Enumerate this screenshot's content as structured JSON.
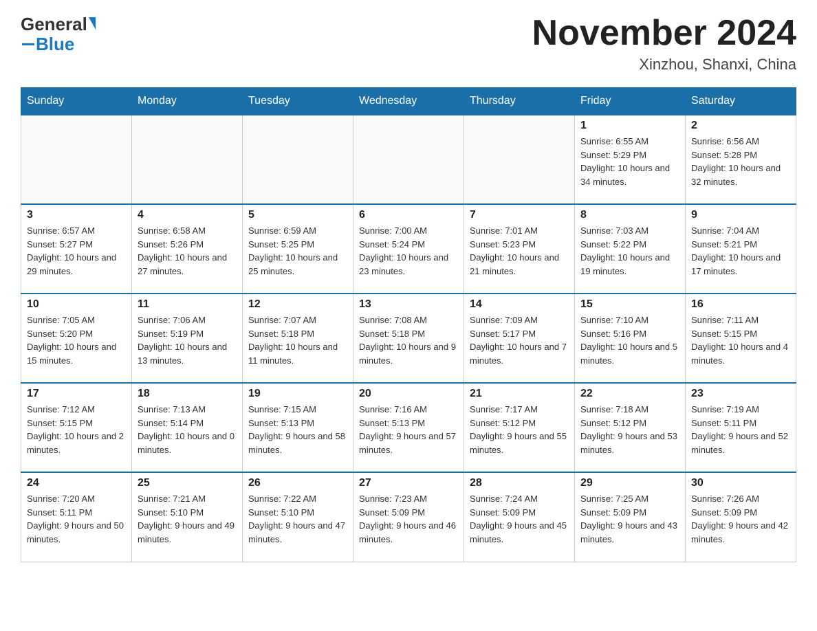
{
  "header": {
    "logo_general": "General",
    "logo_blue": "Blue",
    "month_title": "November 2024",
    "location": "Xinzhou, Shanxi, China"
  },
  "weekdays": [
    "Sunday",
    "Monday",
    "Tuesday",
    "Wednesday",
    "Thursday",
    "Friday",
    "Saturday"
  ],
  "weeks": [
    [
      {
        "day": "",
        "info": ""
      },
      {
        "day": "",
        "info": ""
      },
      {
        "day": "",
        "info": ""
      },
      {
        "day": "",
        "info": ""
      },
      {
        "day": "",
        "info": ""
      },
      {
        "day": "1",
        "info": "Sunrise: 6:55 AM\nSunset: 5:29 PM\nDaylight: 10 hours and 34 minutes."
      },
      {
        "day": "2",
        "info": "Sunrise: 6:56 AM\nSunset: 5:28 PM\nDaylight: 10 hours and 32 minutes."
      }
    ],
    [
      {
        "day": "3",
        "info": "Sunrise: 6:57 AM\nSunset: 5:27 PM\nDaylight: 10 hours and 29 minutes."
      },
      {
        "day": "4",
        "info": "Sunrise: 6:58 AM\nSunset: 5:26 PM\nDaylight: 10 hours and 27 minutes."
      },
      {
        "day": "5",
        "info": "Sunrise: 6:59 AM\nSunset: 5:25 PM\nDaylight: 10 hours and 25 minutes."
      },
      {
        "day": "6",
        "info": "Sunrise: 7:00 AM\nSunset: 5:24 PM\nDaylight: 10 hours and 23 minutes."
      },
      {
        "day": "7",
        "info": "Sunrise: 7:01 AM\nSunset: 5:23 PM\nDaylight: 10 hours and 21 minutes."
      },
      {
        "day": "8",
        "info": "Sunrise: 7:03 AM\nSunset: 5:22 PM\nDaylight: 10 hours and 19 minutes."
      },
      {
        "day": "9",
        "info": "Sunrise: 7:04 AM\nSunset: 5:21 PM\nDaylight: 10 hours and 17 minutes."
      }
    ],
    [
      {
        "day": "10",
        "info": "Sunrise: 7:05 AM\nSunset: 5:20 PM\nDaylight: 10 hours and 15 minutes."
      },
      {
        "day": "11",
        "info": "Sunrise: 7:06 AM\nSunset: 5:19 PM\nDaylight: 10 hours and 13 minutes."
      },
      {
        "day": "12",
        "info": "Sunrise: 7:07 AM\nSunset: 5:18 PM\nDaylight: 10 hours and 11 minutes."
      },
      {
        "day": "13",
        "info": "Sunrise: 7:08 AM\nSunset: 5:18 PM\nDaylight: 10 hours and 9 minutes."
      },
      {
        "day": "14",
        "info": "Sunrise: 7:09 AM\nSunset: 5:17 PM\nDaylight: 10 hours and 7 minutes."
      },
      {
        "day": "15",
        "info": "Sunrise: 7:10 AM\nSunset: 5:16 PM\nDaylight: 10 hours and 5 minutes."
      },
      {
        "day": "16",
        "info": "Sunrise: 7:11 AM\nSunset: 5:15 PM\nDaylight: 10 hours and 4 minutes."
      }
    ],
    [
      {
        "day": "17",
        "info": "Sunrise: 7:12 AM\nSunset: 5:15 PM\nDaylight: 10 hours and 2 minutes."
      },
      {
        "day": "18",
        "info": "Sunrise: 7:13 AM\nSunset: 5:14 PM\nDaylight: 10 hours and 0 minutes."
      },
      {
        "day": "19",
        "info": "Sunrise: 7:15 AM\nSunset: 5:13 PM\nDaylight: 9 hours and 58 minutes."
      },
      {
        "day": "20",
        "info": "Sunrise: 7:16 AM\nSunset: 5:13 PM\nDaylight: 9 hours and 57 minutes."
      },
      {
        "day": "21",
        "info": "Sunrise: 7:17 AM\nSunset: 5:12 PM\nDaylight: 9 hours and 55 minutes."
      },
      {
        "day": "22",
        "info": "Sunrise: 7:18 AM\nSunset: 5:12 PM\nDaylight: 9 hours and 53 minutes."
      },
      {
        "day": "23",
        "info": "Sunrise: 7:19 AM\nSunset: 5:11 PM\nDaylight: 9 hours and 52 minutes."
      }
    ],
    [
      {
        "day": "24",
        "info": "Sunrise: 7:20 AM\nSunset: 5:11 PM\nDaylight: 9 hours and 50 minutes."
      },
      {
        "day": "25",
        "info": "Sunrise: 7:21 AM\nSunset: 5:10 PM\nDaylight: 9 hours and 49 minutes."
      },
      {
        "day": "26",
        "info": "Sunrise: 7:22 AM\nSunset: 5:10 PM\nDaylight: 9 hours and 47 minutes."
      },
      {
        "day": "27",
        "info": "Sunrise: 7:23 AM\nSunset: 5:09 PM\nDaylight: 9 hours and 46 minutes."
      },
      {
        "day": "28",
        "info": "Sunrise: 7:24 AM\nSunset: 5:09 PM\nDaylight: 9 hours and 45 minutes."
      },
      {
        "day": "29",
        "info": "Sunrise: 7:25 AM\nSunset: 5:09 PM\nDaylight: 9 hours and 43 minutes."
      },
      {
        "day": "30",
        "info": "Sunrise: 7:26 AM\nSunset: 5:09 PM\nDaylight: 9 hours and 42 minutes."
      }
    ]
  ]
}
